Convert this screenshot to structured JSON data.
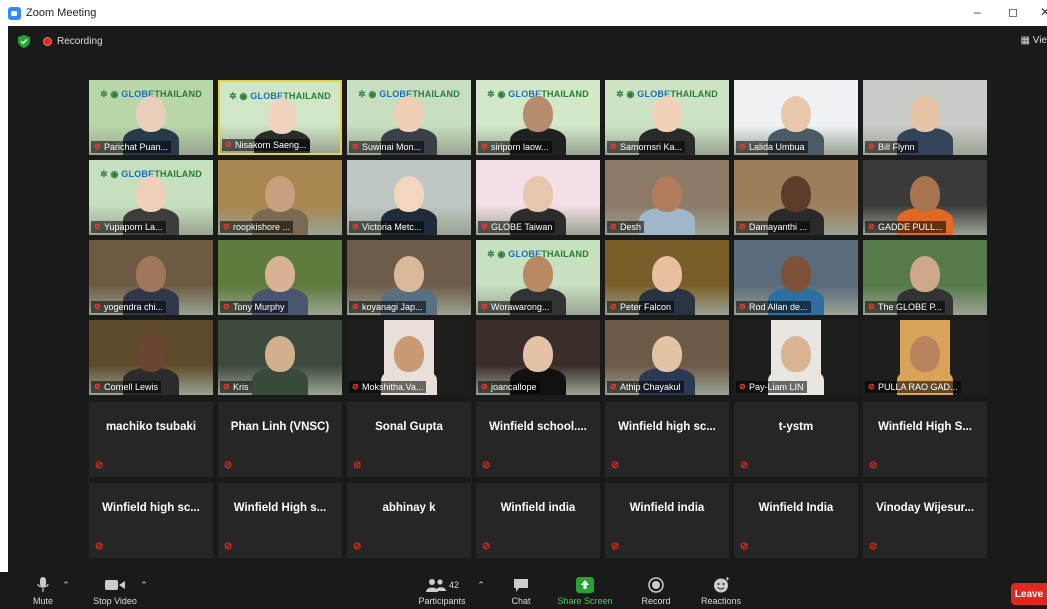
{
  "window": {
    "title": "Zoom Meeting",
    "controls": {
      "minimize": "–",
      "maximize": "◻",
      "close": "✕"
    }
  },
  "meeting": {
    "recording_label": "Recording",
    "view_label": "Vie"
  },
  "video_tiles": [
    {
      "name": "Parichat Puan...",
      "banner": true
    },
    {
      "name": "Nisakorn Saeng...",
      "banner": true,
      "speaking": true
    },
    {
      "name": "Suwinai Mon...",
      "banner": true
    },
    {
      "name": "siriporn laow...",
      "banner": true
    },
    {
      "name": "Samornsri Ka...",
      "banner": true
    },
    {
      "name": "Lalida Umbua",
      "banner": false
    },
    {
      "name": "Bill Flynn",
      "banner": false
    },
    {
      "name": "Yupaporn La...",
      "banner": true
    },
    {
      "name": "roopkishore ...",
      "banner": false
    },
    {
      "name": "Victoria Metc...",
      "banner": false
    },
    {
      "name": "GLOBE Taiwan",
      "banner": false
    },
    {
      "name": "Desh",
      "banner": false
    },
    {
      "name": "Damayanthi ...",
      "banner": false
    },
    {
      "name": "GADDE PULL...",
      "banner": false
    },
    {
      "name": "yogendra chi...",
      "banner": false
    },
    {
      "name": "Tony Murphy",
      "banner": false
    },
    {
      "name": "koyanagi Jap...",
      "banner": false
    },
    {
      "name": "Worawarong...",
      "banner": true
    },
    {
      "name": "Peter Falcon",
      "banner": false
    },
    {
      "name": "Rod Allan de...",
      "banner": false
    },
    {
      "name": "The GLOBE P...",
      "banner": false
    },
    {
      "name": "Cornell Lewis",
      "banner": false
    },
    {
      "name": "Kris",
      "banner": false
    },
    {
      "name": "Mokshitha.Va...",
      "banner": false
    },
    {
      "name": "joancallope",
      "banner": false
    },
    {
      "name": "Athip Chayakul",
      "banner": false
    },
    {
      "name": "Pay-Liam LIN",
      "banner": false
    },
    {
      "name": "PULLA RAO GAD...",
      "banner": false
    }
  ],
  "banner_text": {
    "globe": "GLOBE",
    "thailand": "THAILAND"
  },
  "name_tiles": [
    "machiko tsubaki",
    "Phan Linh (VNSC)",
    "Sonal Gupta",
    "Winfield  school....",
    "Winfield high sc...",
    "t-ystm",
    "Winfield High S...",
    "Winfield high sc...",
    "Winfield High s...",
    "abhinay k",
    "Winfield india",
    "Winfield india",
    "Winfield India",
    "Vinoday  Wijesur..."
  ],
  "toolbar": {
    "mute": "Mute",
    "stop_video": "Stop Video",
    "participants": "Participants",
    "participant_count": "42",
    "chat": "Chat",
    "share_screen": "Share Screen",
    "record": "Record",
    "reactions": "Reactions",
    "leave": "Leave"
  },
  "colors": {
    "background": "#1a1a1a",
    "tile_dark": "#262626",
    "share_green": "#23a534",
    "leave_red": "#e0281c",
    "speaker_highlight": "#e6d33a"
  }
}
